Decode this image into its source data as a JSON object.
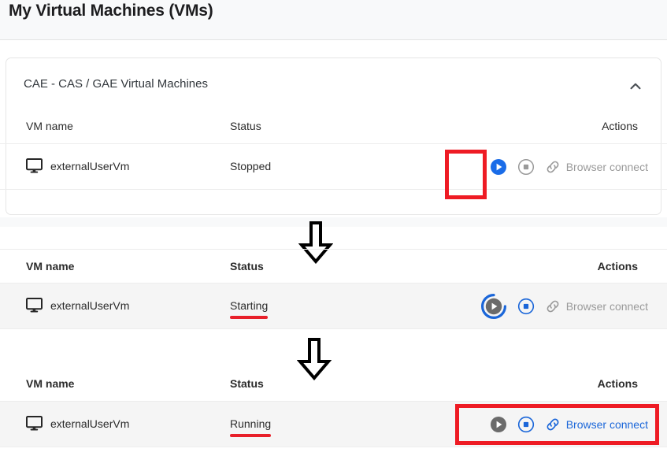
{
  "page": {
    "title": "My Virtual Machines (VMs)"
  },
  "card": {
    "title": "CAE - CAS / GAE Virtual Machines",
    "collapse_icon": "chevron-up-icon"
  },
  "columns": {
    "name": "VM name",
    "status": "Status",
    "actions": "Actions"
  },
  "colors": {
    "accent_blue": "#1a66d9",
    "play_blue": "#1a6ce8",
    "highlight_red": "#ee1b24",
    "underline_red": "#e8202a",
    "disabled_grey": "#9a9a9a",
    "row_hover": "#f5f5f5"
  },
  "sections": [
    {
      "id": "stopped-state",
      "vm_name": "externalUserVm",
      "vm_icon": "monitor-icon",
      "status": "Stopped",
      "status_underlined": false,
      "row_hover": false,
      "headers_bold": false,
      "actions": {
        "play": {
          "icon": "play-circle-icon",
          "state": "enabled-blue"
        },
        "stop": {
          "icon": "stop-circle-icon",
          "state": "disabled-grey"
        },
        "connect": {
          "icon": "link-icon",
          "label": "Browser connect",
          "state": "disabled-grey"
        }
      }
    },
    {
      "id": "starting-state",
      "vm_name": "externalUserVm",
      "vm_icon": "monitor-icon",
      "status": "Starting",
      "status_underlined": true,
      "row_hover": true,
      "headers_bold": true,
      "actions": {
        "play": {
          "icon": "play-circle-icon",
          "state": "disabled-grey-spinner"
        },
        "stop": {
          "icon": "stop-circle-icon",
          "state": "enabled-blue"
        },
        "connect": {
          "icon": "link-icon",
          "label": "Browser connect",
          "state": "disabled-grey"
        }
      }
    },
    {
      "id": "running-state",
      "vm_name": "externalUserVm",
      "vm_icon": "monitor-icon",
      "status": "Running",
      "status_underlined": true,
      "row_hover": true,
      "headers_bold": true,
      "actions": {
        "play": {
          "icon": "play-circle-icon",
          "state": "disabled-grey"
        },
        "stop": {
          "icon": "stop-circle-icon",
          "state": "enabled-blue"
        },
        "connect": {
          "icon": "link-icon",
          "label": "Browser connect",
          "state": "enabled-blue"
        }
      }
    }
  ],
  "annotations": {
    "arrow_icon": "arrow-down-icon",
    "arrow_count": 2,
    "highlight_boxes": [
      {
        "name": "play-button-highlight"
      },
      {
        "name": "actions-group-highlight"
      }
    ]
  }
}
